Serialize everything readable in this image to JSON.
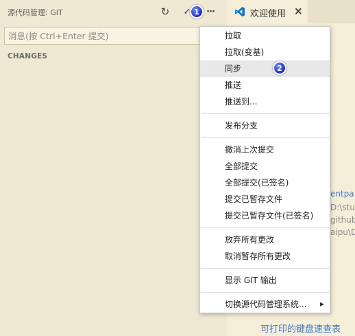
{
  "scm": {
    "title": "源代码管理: GIT",
    "message_placeholder": "消息(按 Ctrl+Enter 提交)",
    "changes_label": "CHANGES",
    "actions": [
      {
        "name": "refresh-icon",
        "glyph": "↻"
      },
      {
        "name": "commit-checkmark-icon",
        "glyph": "✓"
      },
      {
        "name": "more-actions-icon",
        "glyph": "···"
      }
    ]
  },
  "tab": {
    "label": "欢迎使用",
    "close": "×",
    "icon": "vscode-logo-icon"
  },
  "editor": {
    "peek_texts": [
      "entpa",
      "D:\\stuc",
      "github",
      "aipu\\D"
    ],
    "bottom_link": "可打印的键盘速查表"
  },
  "menu": {
    "groups": [
      [
        "拉取",
        "拉取(变基)",
        "同步",
        "推送",
        "推送到..."
      ],
      [
        "发布分支"
      ],
      [
        "撤消上次提交",
        "全部提交",
        "全部提交(已签名)",
        "提交已暂存文件",
        "提交已暂存文件(已签名)"
      ],
      [
        "放弃所有更改",
        "取消暂存所有更改"
      ],
      [
        "显示 GIT 输出"
      ],
      [
        "切换源代码管理系统..."
      ]
    ],
    "highlighted": "同步",
    "submenu_arrow": "▶"
  },
  "badges": [
    "1",
    "2"
  ],
  "colors": {
    "panel_bg": "#efe8d3",
    "editor_bg": "#f5eed9",
    "menu_bg": "#ffffff",
    "menu_hover": "#e8e8e8",
    "link": "#3f78c4",
    "badge": "#1e2fbf",
    "vscode_blue": "#0078d7"
  }
}
